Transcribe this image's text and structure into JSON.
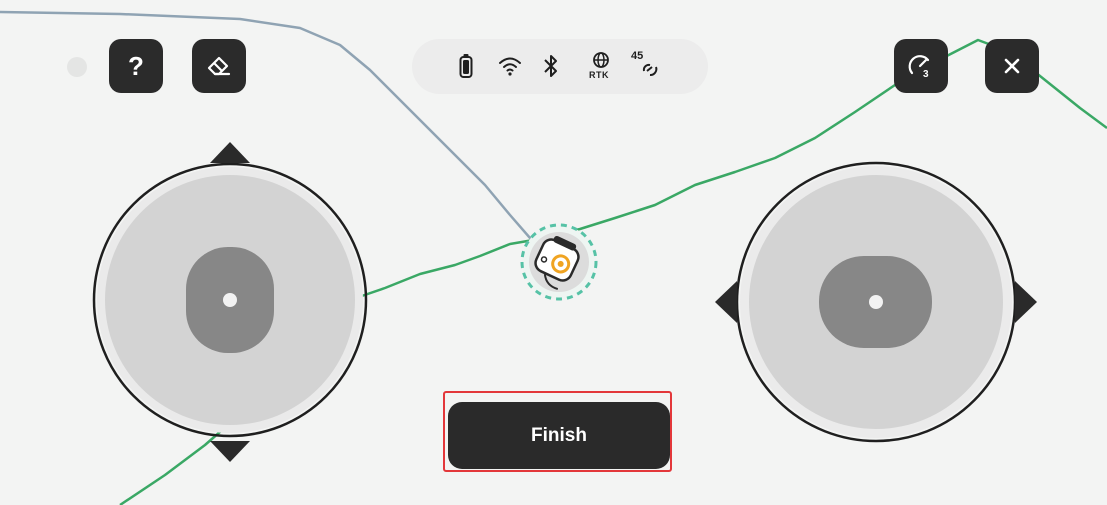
{
  "toolbar": {
    "help_label": "?",
    "speed_badge": "3"
  },
  "status": {
    "rtk_label": "RTK",
    "satellite_count": "45"
  },
  "actions": {
    "finish_label": "Finish"
  },
  "colors": {
    "background": "#f3f4f3",
    "button": "#2b2b2b",
    "path_completed": "#8fa3b3",
    "path_planned": "#3aa865",
    "robot_ring": "#56c2a6",
    "highlight_outline": "#e3373a",
    "robot_accent": "#f0a422"
  },
  "icons": {
    "help": "question-mark-icon",
    "erase": "eraser-icon",
    "battery": "battery-icon",
    "wifi": "wifi-icon",
    "bluetooth": "bluetooth-icon",
    "rtk": "rtk-globe-icon",
    "satellite": "satellite-link-icon",
    "speed": "speedometer-icon",
    "close": "close-icon"
  }
}
